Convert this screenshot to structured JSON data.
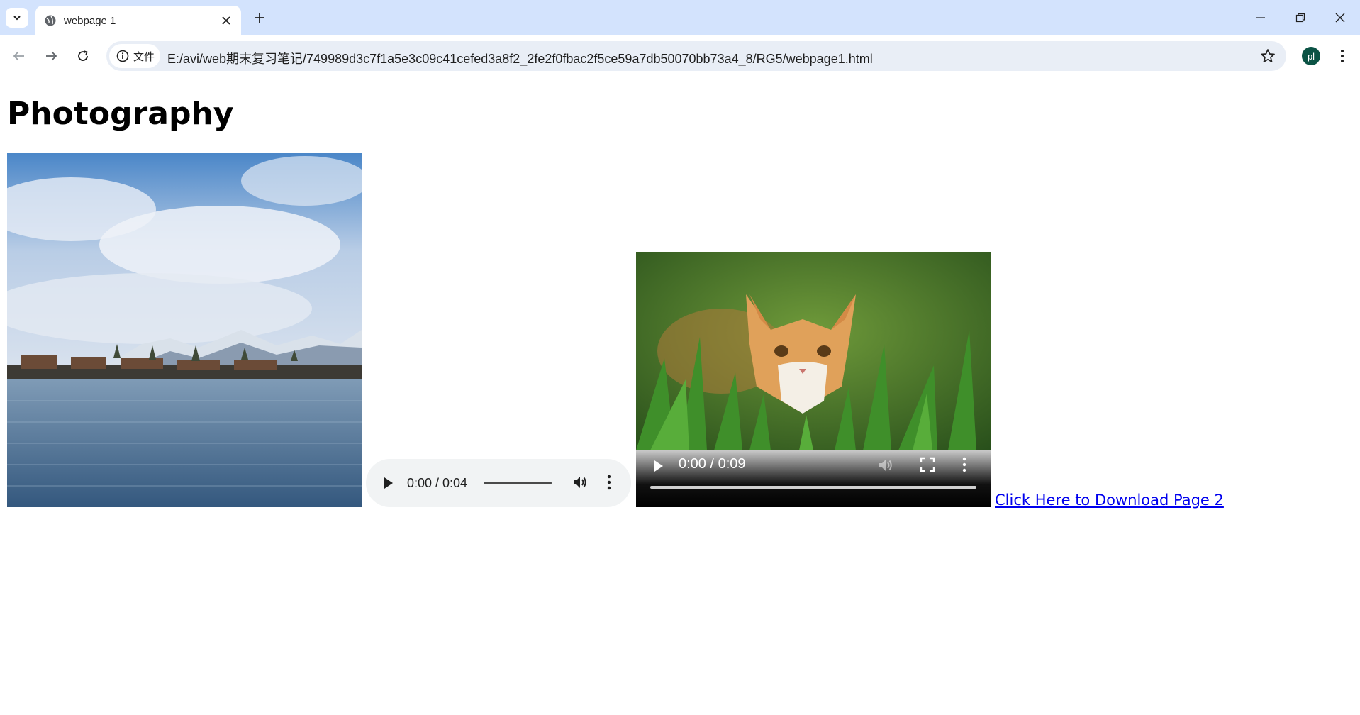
{
  "browser": {
    "tab_title": "webpage 1",
    "address_chip": "文件",
    "url": "E:/avi/web期末复习笔记/749989d3c7f1a5e3c09c41cefed3a8f2_2fe2f0fbac2f5ce59a7db50070bb73a4_8/RG5/webpage1.html",
    "profile_initials": "pl"
  },
  "page": {
    "heading": "Photography",
    "audio": {
      "time": "0:00 / 0:04"
    },
    "video": {
      "time": "0:00 / 0:09"
    },
    "download_link": "Click Here to Download Page 2"
  }
}
